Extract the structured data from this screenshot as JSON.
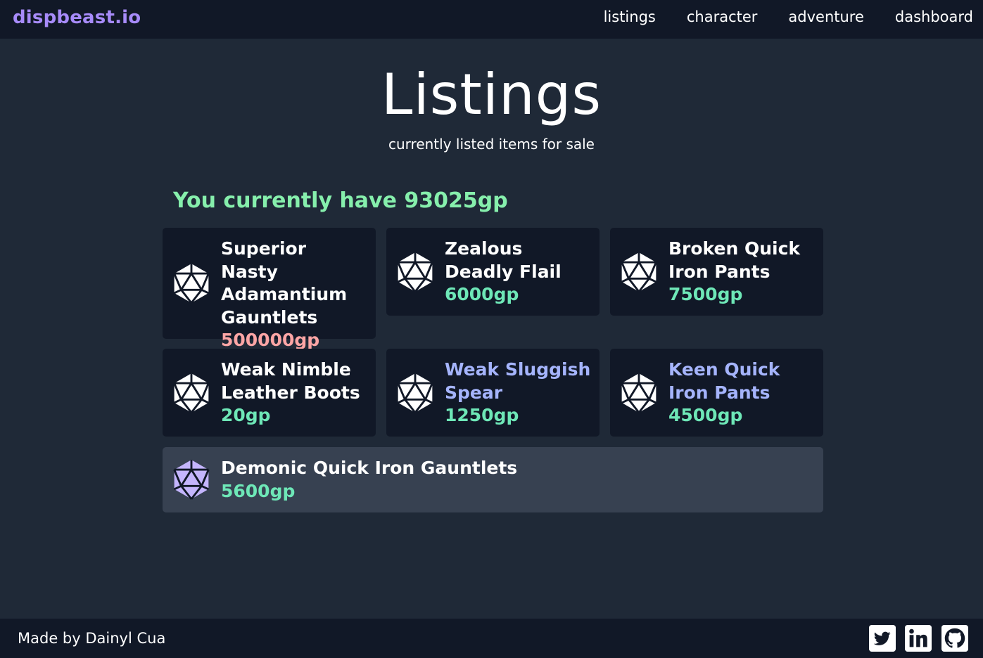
{
  "nav": {
    "brand": "dispbeast.io",
    "links": [
      "listings",
      "character",
      "adventure",
      "dashboard"
    ]
  },
  "page": {
    "title": "Listings",
    "subtitle": "currently listed items for sale",
    "balance": "You currently have 93025gp"
  },
  "listings": [
    {
      "name": "Superior Nasty Adamantium Gauntlets",
      "price": "500000gp",
      "icon": "d20-icon"
    },
    {
      "name": "Zealous Deadly Flail",
      "price": "6000gp",
      "icon": "d20-icon"
    },
    {
      "name": "Broken Quick Iron Pants",
      "price": "7500gp",
      "icon": "d20-icon"
    },
    {
      "name": "Weak Nimble Leather Boots",
      "price": "20gp",
      "icon": "d20-icon"
    },
    {
      "name": "Weak Sluggish Spear",
      "price": "1250gp",
      "icon": "d20-icon"
    },
    {
      "name": "Keen Quick Iron Pants",
      "price": "4500gp",
      "icon": "d20-icon"
    },
    {
      "name": "Demonic Quick Iron Gauntlets",
      "price": "5600gp",
      "icon": "d20-icon"
    }
  ],
  "footer": {
    "credit": "Made by Dainyl Cua",
    "social_icons": [
      "twitter-icon",
      "linkedin-icon",
      "github-icon"
    ]
  },
  "colors": {
    "brand": "#a78bfa",
    "balance": "#86efac",
    "affordable_price": "#6ee7b7",
    "unaffordable_price": "#fca5a5",
    "highlight_name": "#a5b4fc",
    "background": "#1f2937",
    "card": "#111827",
    "card_highlight": "#374151"
  }
}
